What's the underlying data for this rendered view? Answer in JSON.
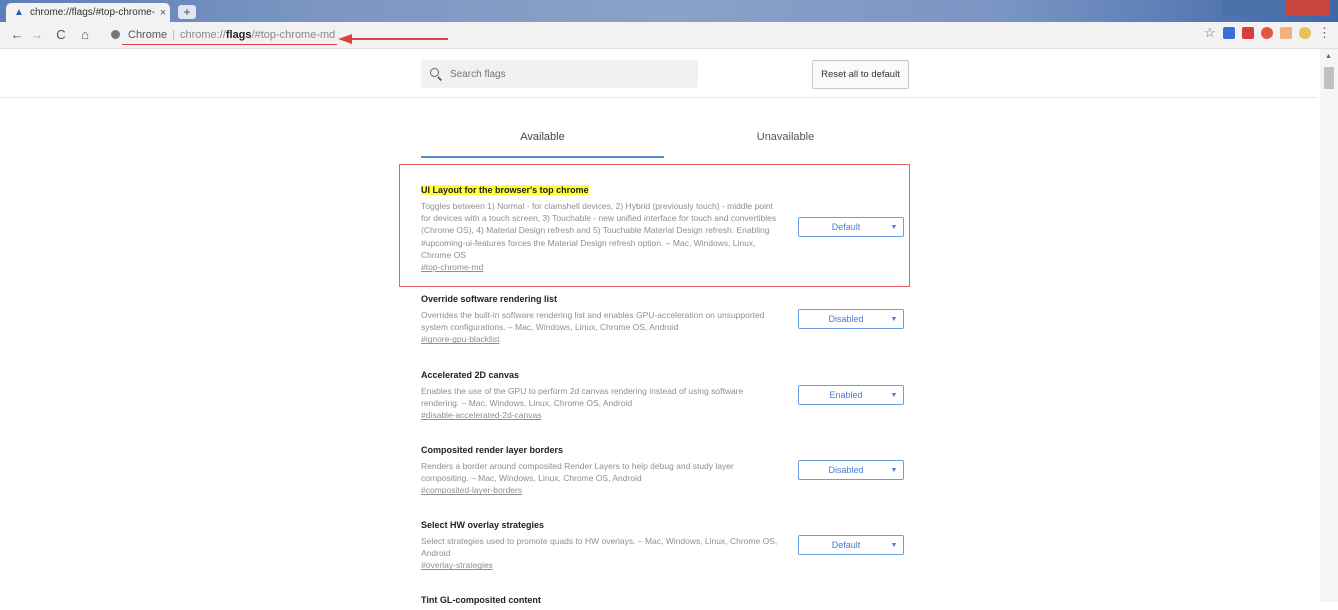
{
  "browser": {
    "tab_title": "chrome://flags/#top-chrome-",
    "tab_close": "×",
    "new_tab": "+",
    "omnibox_chip": "Chrome",
    "omnibox_sep": "|",
    "url_prefix": "chrome://",
    "url_bold": "flags",
    "url_suffix": "/#top-chrome-md"
  },
  "nav": {
    "back": "←",
    "forward": "→",
    "reload": "C",
    "home": "⌂"
  },
  "toolbar_icons": {
    "star": "☆",
    "menu": "⋮"
  },
  "search": {
    "placeholder": "Search flags"
  },
  "reset_button": "Reset all to default",
  "tabs": {
    "available": "Available",
    "unavailable": "Unavailable"
  },
  "experiments": [
    {
      "title": "UI Layout for the browser's top chrome",
      "description": "Toggles between 1) Normal - for clamshell devices, 2) Hybrid (previously touch) - middle point for devices with a touch screen, 3) Touchable - new unified interface for touch and convertibles (Chrome OS), 4) Material Design refresh and 5) Touchable Material Design refresh. Enabling #upcoming-ui-features forces the Material Design refresh option. – Mac, Windows, Linux, Chrome OS",
      "link": "#top-chrome-md",
      "value": "Default"
    },
    {
      "title": "Override software rendering list",
      "description": "Overrides the built-in software rendering list and enables GPU-acceleration on unsupported system configurations. – Mac, Windows, Linux, Chrome OS, Android",
      "link": "#ignore-gpu-blacklist",
      "value": "Disabled"
    },
    {
      "title": "Accelerated 2D canvas",
      "description": "Enables the use of the GPU to perform 2d canvas rendering instead of using software rendering. – Mac, Windows, Linux, Chrome OS, Android",
      "link": "#disable-accelerated-2d-canvas",
      "value": "Enabled"
    },
    {
      "title": "Composited render layer borders",
      "description": "Renders a border around composited Render Layers to help debug and study layer compositing. – Mac, Windows, Linux, Chrome OS, Android",
      "link": "#composited-layer-borders",
      "value": "Disabled"
    },
    {
      "title": "Select HW overlay strategies",
      "description": "Select strategies used to promote quads to HW overlays. – Mac, Windows, Linux, Chrome OS, Android",
      "link": "#overlay-strategies",
      "value": "Default"
    },
    {
      "title": "Tint GL-composited content",
      "description": "",
      "link": "",
      "value": ""
    }
  ],
  "colors": {
    "highlight": "#ffff3a",
    "annotation_red": "#e04040",
    "select_blue": "#4a7bd0",
    "tab_underline": "#5a8ad6"
  }
}
